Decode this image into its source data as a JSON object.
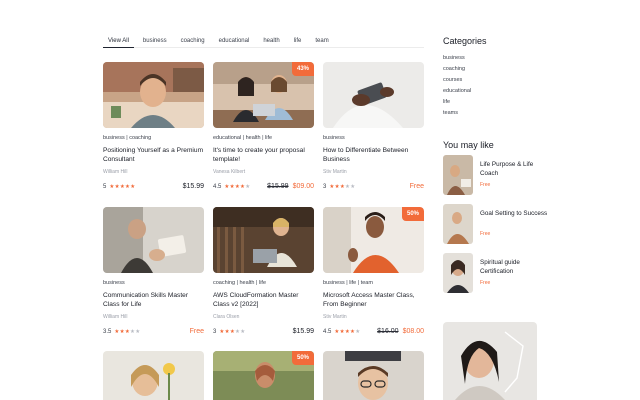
{
  "tabs": [
    "View All",
    "business",
    "coaching",
    "educational",
    "health",
    "life",
    "team"
  ],
  "courses": [
    {
      "cats": "business | coaching",
      "title": "Positioning Yourself as a Premium Consultant",
      "author": "William Hill",
      "rating": "5",
      "stars": 5,
      "old_price": "",
      "price": "$15.99",
      "badge": "",
      "price_style": "normal"
    },
    {
      "cats": "educational | health | life",
      "title": "It's time to create your proposal template!",
      "author": "Vanesa Kilbert",
      "rating": "4.5",
      "stars": 4,
      "old_price": "$15.99",
      "price": "$09.00",
      "badge": "43%",
      "price_style": "sale"
    },
    {
      "cats": "business",
      "title": "How to Differentiate Between Business",
      "author": "Stiv Martin",
      "rating": "3",
      "stars": 3,
      "old_price": "",
      "price": "Free",
      "badge": "",
      "price_style": "free"
    },
    {
      "cats": "business",
      "title": "Communication Skills Master Class for Life",
      "author": "William Hill",
      "rating": "3.5",
      "stars": 3,
      "old_price": "",
      "price": "Free",
      "badge": "",
      "price_style": "free"
    },
    {
      "cats": "coaching | health | life",
      "title": "AWS CloudFormation Master Class v2 [2022]",
      "author": "Clara Olsen",
      "rating": "3",
      "stars": 3,
      "old_price": "",
      "price": "$15.99",
      "badge": "",
      "price_style": "normal"
    },
    {
      "cats": "business | life | team",
      "title": "Microsoft Access Master Class, From Beginner",
      "author": "Stiv Martin",
      "rating": "4.5",
      "stars": 4,
      "old_price": "$16.00",
      "price": "$08.00",
      "badge": "50%",
      "price_style": "sale"
    },
    {
      "cats": "",
      "title": "",
      "author": "",
      "rating": "",
      "stars": 0,
      "old_price": "",
      "price": "",
      "badge": "",
      "price_style": "normal"
    },
    {
      "cats": "",
      "title": "",
      "author": "",
      "rating": "",
      "stars": 0,
      "old_price": "",
      "price": "",
      "badge": "50%",
      "price_style": "normal"
    },
    {
      "cats": "",
      "title": "",
      "author": "",
      "rating": "",
      "stars": 0,
      "old_price": "",
      "price": "",
      "badge": "",
      "price_style": "normal"
    }
  ],
  "sidebar": {
    "categories_title": "Categories",
    "categories": [
      "business",
      "coaching",
      "courses",
      "educational",
      "life",
      "teams"
    ],
    "recommend_title": "You may like",
    "recommended": [
      {
        "title": "Life Purpose & Life Coach",
        "price": "Free"
      },
      {
        "title": "Goal Setting to Success",
        "price": "Free"
      },
      {
        "title": "Spiritual guide Certification",
        "price": "Free"
      }
    ]
  },
  "colors": {
    "accent": "#f26b3a",
    "text": "#1a1d26",
    "muted": "#9a9ea8"
  }
}
